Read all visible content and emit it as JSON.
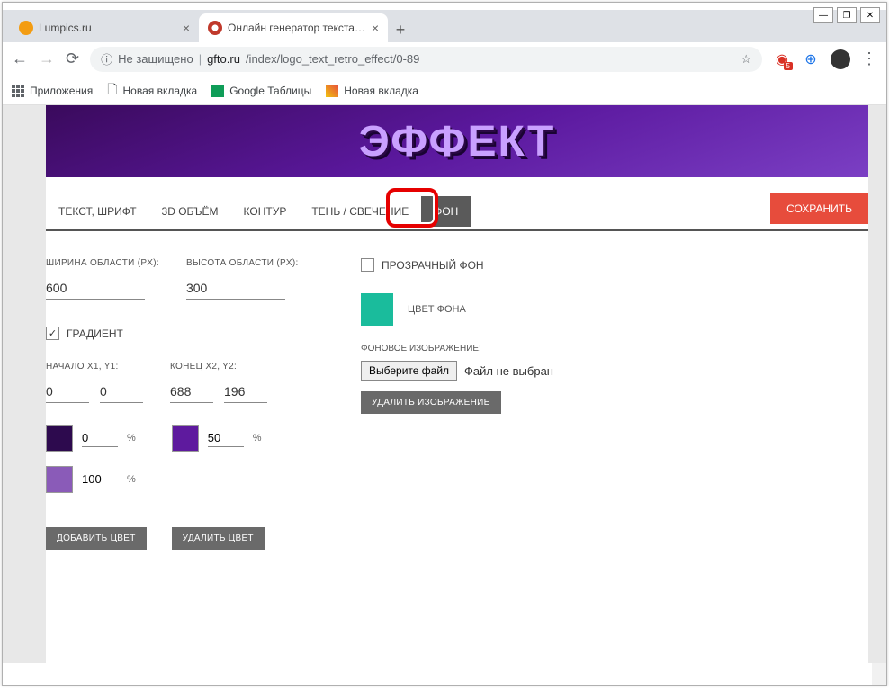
{
  "browser": {
    "tabs": [
      {
        "title": "Lumpics.ru",
        "favicon": "#f39c12"
      },
      {
        "title": "Онлайн генератор текста созда",
        "favicon": "#c0392b"
      }
    ],
    "security_label": "Не защищено",
    "url_host": "gfto.ru",
    "url_path": "/index/logo_text_retro_effect/0-89",
    "bookmarks": [
      {
        "label": "Приложения",
        "icon": "apps"
      },
      {
        "label": "Новая вкладка",
        "icon": "page"
      },
      {
        "label": "Google Таблицы",
        "icon": "sheets"
      },
      {
        "label": "Новая вкладка",
        "icon": "bookmark"
      }
    ]
  },
  "preview_text": "ЭФФЕКТ",
  "editor_tabs": [
    "ТЕКСТ, ШРИФТ",
    "3D ОБЪЁМ",
    "КОНТУР",
    "ТЕНЬ / СВЕЧЕНИЕ",
    "ФОН"
  ],
  "save_label": "СОХРАНИТЬ",
  "left_panel": {
    "width_label": "ШИРИНА ОБЛАСТИ (PX):",
    "width_value": "600",
    "height_label": "ВЫСОТА ОБЛАСТИ (PX):",
    "height_value": "300",
    "gradient_label": "ГРАДИЕНТ",
    "start_label": "НАЧАЛО X1, Y1:",
    "start_x": "0",
    "start_y": "0",
    "end_label": "КОНЕЦ X2, Y2:",
    "end_x": "688",
    "end_y": "196",
    "gradient_stops": [
      {
        "color": "#2d0a4e",
        "value": "0"
      },
      {
        "color": "#5e1a9e",
        "value": "50"
      },
      {
        "color": "#8a5bb8",
        "value": "100"
      }
    ],
    "add_color_label": "ДОБАВИТЬ ЦВЕТ",
    "remove_color_label": "УДАЛИТЬ ЦВЕТ"
  },
  "right_panel": {
    "transparent_label": "ПРОЗРАЧНЫЙ ФОН",
    "bg_color": "#1abc9c",
    "bg_color_label": "ЦВЕТ ФОНА",
    "bg_image_label": "ФОНОВОЕ ИЗОБРАЖЕНИЕ:",
    "choose_file_label": "Выберите файл",
    "no_file_label": "Файл не выбран",
    "remove_image_label": "УДАЛИТЬ ИЗОБРАЖЕНИЕ"
  }
}
